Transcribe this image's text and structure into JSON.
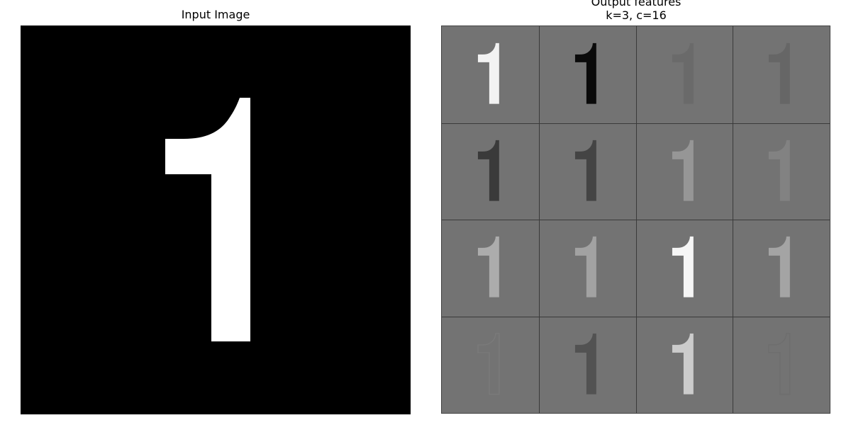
{
  "titles": {
    "input": "Input Image",
    "output_line1": "Output features",
    "output_line2": "k=3, c=16"
  },
  "input_image": {
    "digit": "1",
    "background_color": "#000000",
    "digit_color": "#ffffff"
  },
  "output_grid": {
    "rows": 4,
    "cols": 4,
    "background_color": "#737373",
    "feature_maps": [
      {
        "index": 0,
        "digit": "1",
        "tone": "#f2f2f2"
      },
      {
        "index": 1,
        "digit": "1",
        "tone": "#0a0a0a"
      },
      {
        "index": 2,
        "digit": "1",
        "tone": "#6a6a6a"
      },
      {
        "index": 3,
        "digit": "1",
        "tone": "#666666"
      },
      {
        "index": 4,
        "digit": "1",
        "tone": "#3a3a3a"
      },
      {
        "index": 5,
        "digit": "1",
        "tone": "#444444"
      },
      {
        "index": 6,
        "digit": "1",
        "tone": "#969696"
      },
      {
        "index": 7,
        "digit": "1",
        "tone": "#828282"
      },
      {
        "index": 8,
        "digit": "1",
        "tone": "#acacac"
      },
      {
        "index": 9,
        "digit": "1",
        "tone": "#a2a2a2"
      },
      {
        "index": 10,
        "digit": "1",
        "tone": "#f6f6f6"
      },
      {
        "index": 11,
        "digit": "1",
        "tone": "#a4a4a4"
      },
      {
        "index": 12,
        "digit": "1",
        "tone": "#7a7a7a",
        "edge": true
      },
      {
        "index": 13,
        "digit": "1",
        "tone": "#525252"
      },
      {
        "index": 14,
        "digit": "1",
        "tone": "#cccccc"
      },
      {
        "index": 15,
        "digit": "1",
        "tone": "#6e6e6e",
        "edge": true
      }
    ]
  }
}
